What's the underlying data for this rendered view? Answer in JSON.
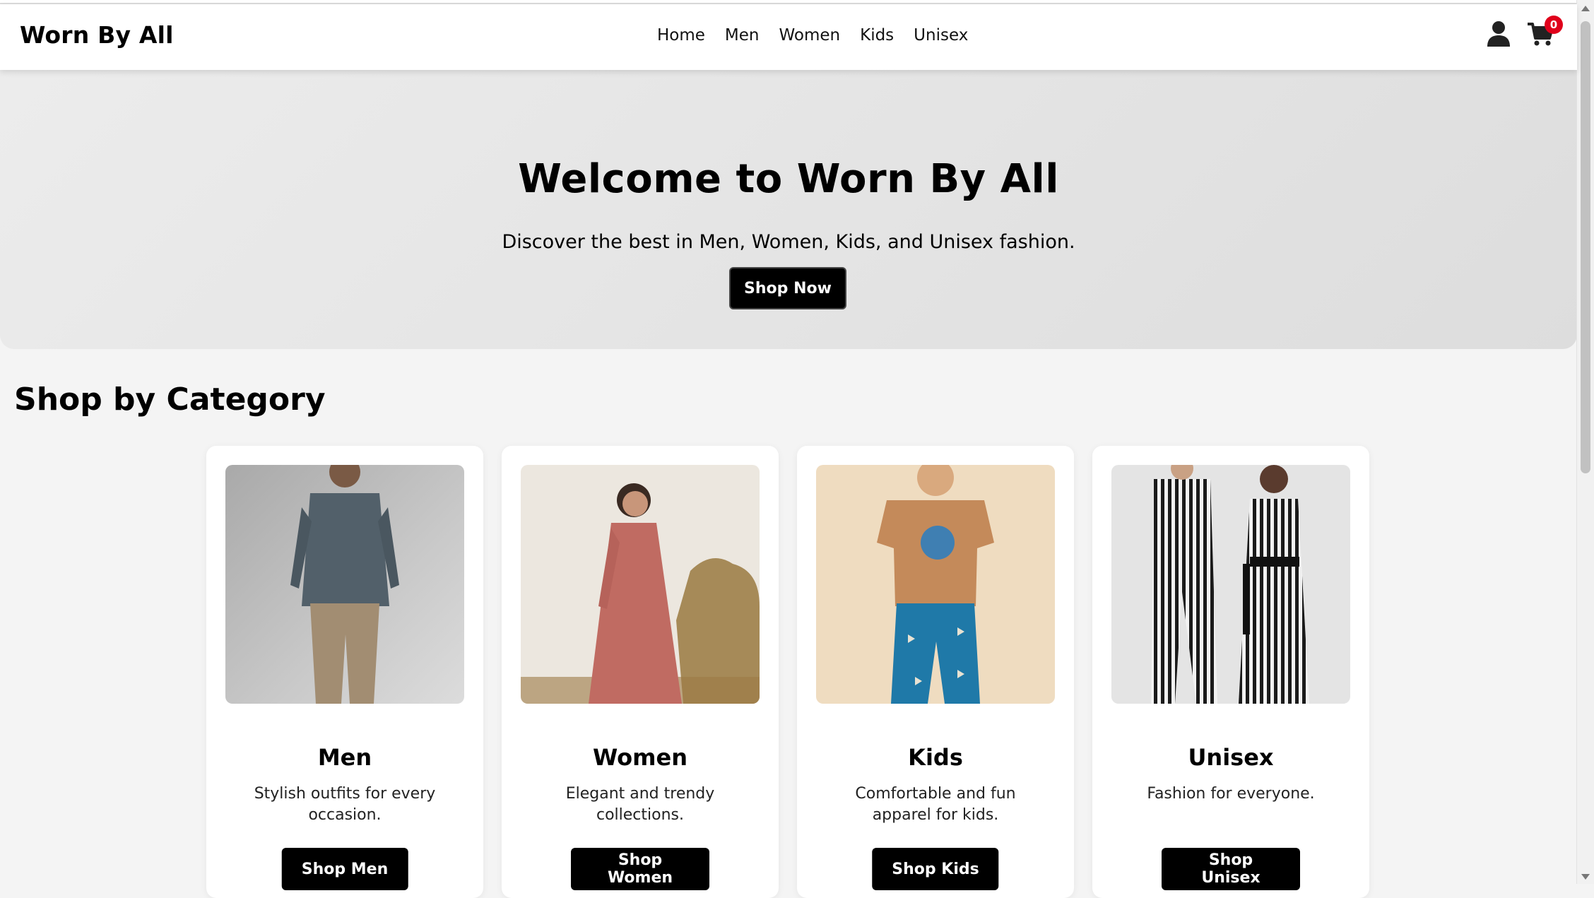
{
  "header": {
    "brand": "Worn By All",
    "nav": [
      "Home",
      "Men",
      "Women",
      "Kids",
      "Unisex"
    ],
    "cart_count": "0",
    "icons": [
      "user-icon",
      "cart-icon"
    ]
  },
  "hero": {
    "title": "Welcome to Worn By All",
    "subtitle": "Discover the best in Men, Women, Kids, and Unisex fashion.",
    "button": "Shop Now"
  },
  "categories": {
    "heading": "Shop by Category",
    "items": [
      {
        "title": "Men",
        "description": "Stylish outfits for every occasion.",
        "button": "Shop Men"
      },
      {
        "title": "Women",
        "description": "Elegant and trendy collections.",
        "button": "Shop Women"
      },
      {
        "title": "Kids",
        "description": "Comfortable and fun apparel for kids.",
        "button": "Shop Kids"
      },
      {
        "title": "Unisex",
        "description": "Fashion for everyone.",
        "button": "Shop Unisex"
      }
    ]
  },
  "colors": {
    "accent": "#000000",
    "badge": "#e0001b",
    "page_bg": "#f4f4f4"
  }
}
